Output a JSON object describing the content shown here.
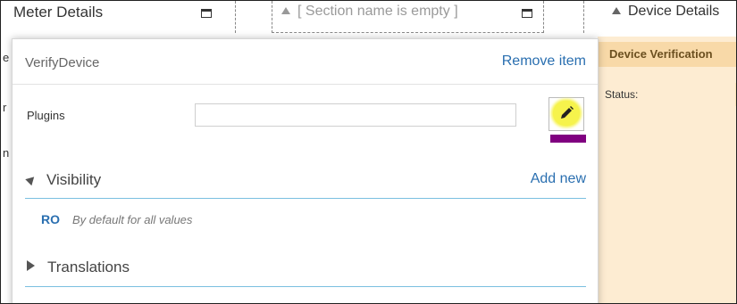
{
  "background": {
    "meter_details_title": "Meter Details",
    "section_placeholder": "[ Section name is empty ]",
    "device_details_title": "Device Details",
    "device_verification_tab": "Device Verification",
    "status_label": "Status:",
    "left_stubs": [
      "e",
      "r",
      "n"
    ]
  },
  "popup": {
    "title": "VerifyDevice",
    "remove_label": "Remove item",
    "plugins": {
      "label": "Plugins",
      "value": ""
    },
    "visibility": {
      "label": "Visibility",
      "add_label": "Add new",
      "rule": {
        "code": "RO",
        "description": "By default for all values"
      }
    },
    "translations": {
      "label": "Translations"
    }
  },
  "colors": {
    "link": "#2a6fb0",
    "highlight": "#f6f34c",
    "marker": "#800080",
    "panel_bg": "#fdecd2",
    "tab_bg": "#f8d9a8",
    "divider": "#7ac0e0"
  },
  "icons": {
    "maximize": "maximize-icon",
    "edit": "pencil-icon",
    "collapse": "triangle-down-icon",
    "expand": "triangle-right-icon"
  }
}
